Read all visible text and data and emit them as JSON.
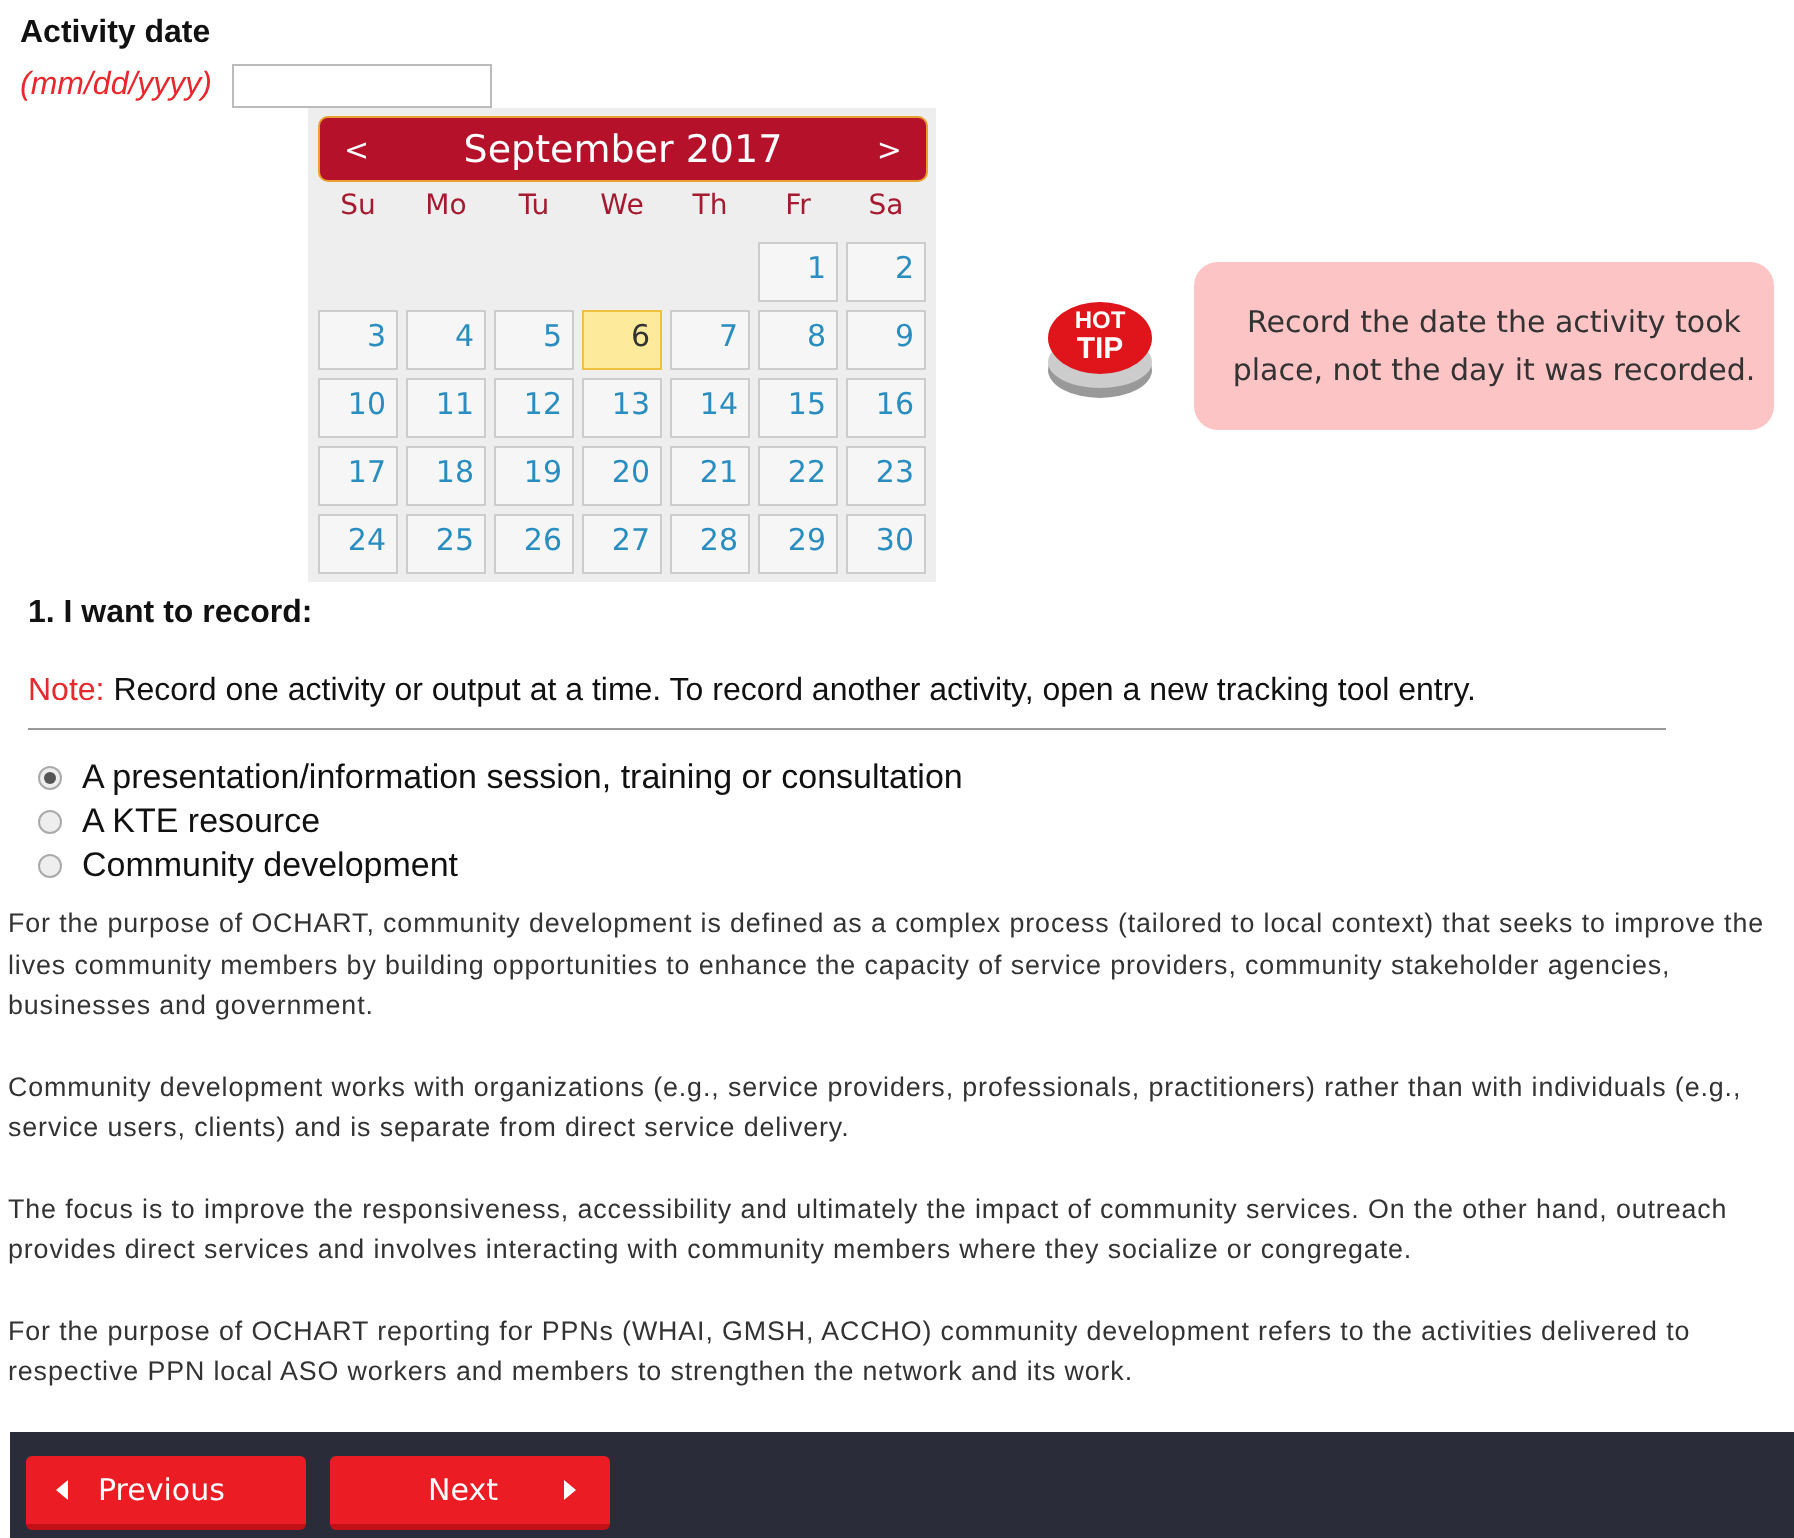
{
  "date_field": {
    "label": "Activity date",
    "hint": "(mm/dd/yyyy)"
  },
  "calendar": {
    "prev": "<",
    "title": "September 2017",
    "next": ">",
    "weekdays": [
      "Su",
      "Mo",
      "Tu",
      "We",
      "Th",
      "Fr",
      "Sa"
    ],
    "weeks": [
      [
        {
          "kind": "empty"
        },
        {
          "kind": "empty"
        },
        {
          "kind": "empty"
        },
        {
          "kind": "empty"
        },
        {
          "kind": "empty"
        },
        {
          "kind": "day",
          "day": "1",
          "selected": false
        },
        {
          "kind": "day",
          "day": "2",
          "selected": false
        }
      ],
      [
        {
          "kind": "day",
          "day": "3",
          "selected": false
        },
        {
          "kind": "day",
          "day": "4",
          "selected": false
        },
        {
          "kind": "day",
          "day": "5",
          "selected": false
        },
        {
          "kind": "day",
          "day": "6",
          "selected": true
        },
        {
          "kind": "day",
          "day": "7",
          "selected": false
        },
        {
          "kind": "day",
          "day": "8",
          "selected": false
        },
        {
          "kind": "day",
          "day": "9",
          "selected": false
        }
      ],
      [
        {
          "kind": "day",
          "day": "10",
          "selected": false
        },
        {
          "kind": "day",
          "day": "11",
          "selected": false
        },
        {
          "kind": "day",
          "day": "12",
          "selected": false
        },
        {
          "kind": "day",
          "day": "13",
          "selected": false
        },
        {
          "kind": "day",
          "day": "14",
          "selected": false
        },
        {
          "kind": "day",
          "day": "15",
          "selected": false
        },
        {
          "kind": "day",
          "day": "16",
          "selected": false
        }
      ],
      [
        {
          "kind": "day",
          "day": "17",
          "selected": false
        },
        {
          "kind": "day",
          "day": "18",
          "selected": false
        },
        {
          "kind": "day",
          "day": "19",
          "selected": false
        },
        {
          "kind": "day",
          "day": "20",
          "selected": false
        },
        {
          "kind": "day",
          "day": "21",
          "selected": false
        },
        {
          "kind": "day",
          "day": "22",
          "selected": false
        },
        {
          "kind": "day",
          "day": "23",
          "selected": false
        }
      ],
      [
        {
          "kind": "day",
          "day": "24",
          "selected": false
        },
        {
          "kind": "day",
          "day": "25",
          "selected": false
        },
        {
          "kind": "day",
          "day": "26",
          "selected": false
        },
        {
          "kind": "day",
          "day": "27",
          "selected": false
        },
        {
          "kind": "day",
          "day": "28",
          "selected": false
        },
        {
          "kind": "day",
          "day": "29",
          "selected": false
        },
        {
          "kind": "day",
          "day": "30",
          "selected": false
        }
      ]
    ]
  },
  "tip": {
    "badge_top": "HOT",
    "badge_bottom": "TIP",
    "text": "Record the date the activity took place, not the day it was recorded."
  },
  "question": {
    "title": "1. I want to record:",
    "note_label": "Note:",
    "note": "Record one activity or output at a time. To record another activity, open a new tracking tool entry.",
    "options": [
      {
        "label": "A presentation/information session, training or consultation",
        "selected": true
      },
      {
        "label": "A KTE resource",
        "selected": false
      },
      {
        "label": "Community development",
        "selected": false
      }
    ]
  },
  "paragraphs": [
    "For the purpose of OCHART, community development is defined as a complex process (tailored to local context) that seeks to improve the lives community members by building opportunities to enhance the capacity of service providers, community stakeholder agencies, businesses and government.",
    "Community development works with organizations (e.g., service providers, professionals, practitioners) rather than with individuals (e.g., service users, clients) and is separate from direct service delivery.",
    "The focus is to improve the responsiveness, accessibility and ultimately the impact of community services. On the other hand, outreach provides direct services and involves interacting with community members where they socialize or congregate.",
    "For the purpose of OCHART reporting for PPNs (WHAI, GMSH, ACCHO) community development refers to the activities delivered to respective PPN local ASO workers and members to strengthen the network and its work."
  ],
  "footer": {
    "previous": "Previous",
    "next": "Next"
  }
}
